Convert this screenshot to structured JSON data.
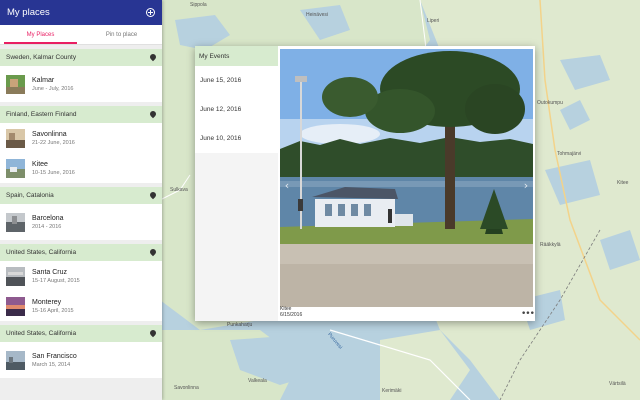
{
  "sidebar": {
    "title": "My places",
    "add_icon": "add-circle-icon",
    "tabs": [
      {
        "label": "My Places",
        "active": true
      },
      {
        "label": "Pin to place",
        "active": false
      }
    ],
    "groups": [
      {
        "name": "Sweden, Kalmar County",
        "places": [
          {
            "name": "Kalmar",
            "date": "June - July, 2016"
          }
        ]
      },
      {
        "name": "Finland, Eastern Finland",
        "places": [
          {
            "name": "Savonlinna",
            "date": "21-22 June, 2016"
          },
          {
            "name": "Kitee",
            "date": "10-15 June, 2016"
          }
        ]
      },
      {
        "name": "Spain, Catalonia",
        "places": [
          {
            "name": "Barcelona",
            "date": "2014 - 2016"
          }
        ]
      },
      {
        "name": "United States, California",
        "places": [
          {
            "name": "Santa Cruz",
            "date": "15-17 August, 2015"
          },
          {
            "name": "Monterey",
            "date": "15-16 April, 2015"
          }
        ]
      },
      {
        "name": "United States, California",
        "places": [
          {
            "name": "San Francisco",
            "date": "March 15, 2014"
          }
        ]
      }
    ]
  },
  "popup": {
    "events_header": "My Events",
    "events": [
      "June 15, 2016",
      "June 12, 2016",
      "June 10, 2016"
    ],
    "photo_title": "Kitee",
    "photo_date": "6/15/2016",
    "more_icon": "more-horizontal-icon"
  },
  "map": {
    "labels": [
      "Kitee",
      "Savonlinna",
      "Joensuu",
      "Tohmajärvi",
      "Lieksa",
      "Kerimäki",
      "Rääkkylä",
      "Punkaharju"
    ]
  },
  "colors": {
    "header": "#283593",
    "accent": "#e91e63",
    "group_bg": "#d7ebcf",
    "marker": "#e53935"
  }
}
